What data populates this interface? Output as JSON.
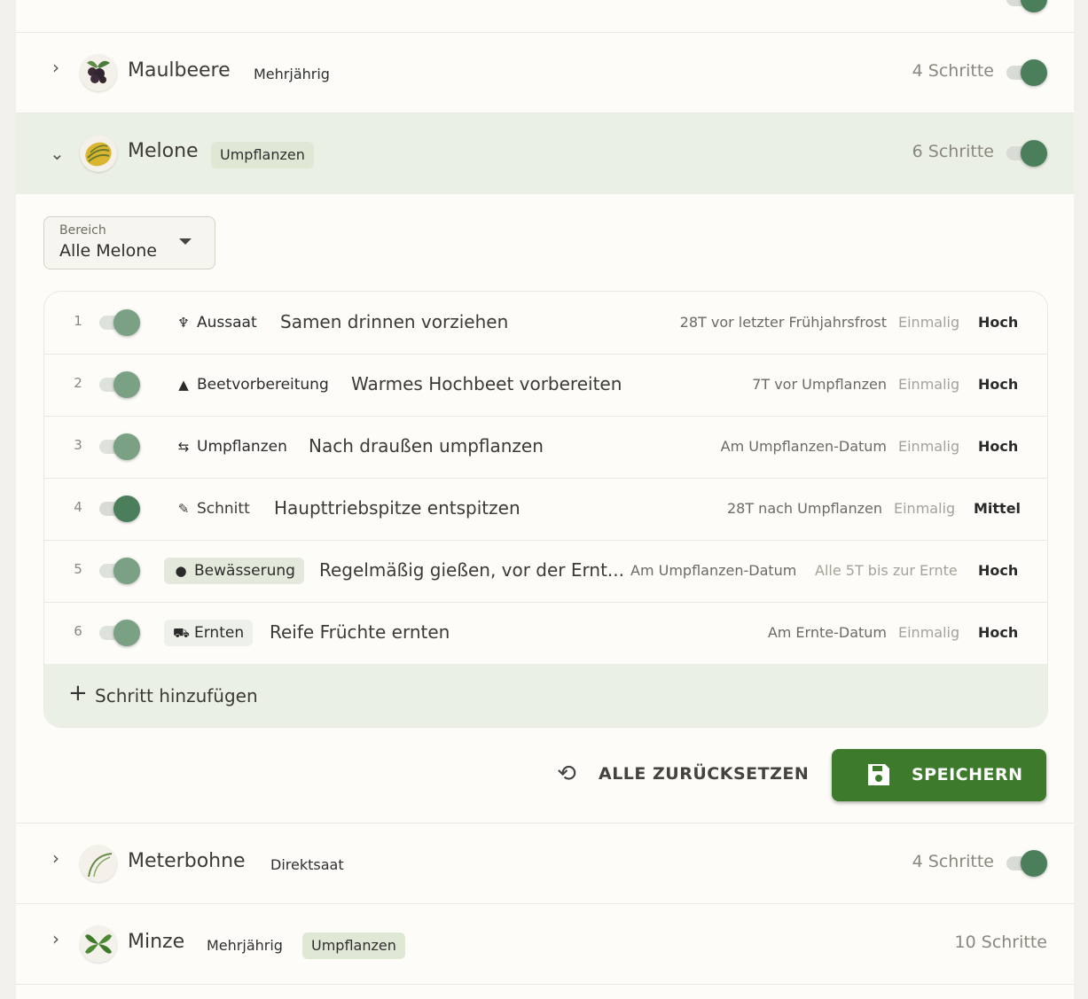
{
  "crops": {
    "maulbeere": {
      "name": "Maulbeere",
      "tags": [
        "Mehrjährig"
      ],
      "steps": "4 Schritte",
      "icon": "mulberry-icon",
      "enabled": true
    },
    "melone": {
      "name": "Melone",
      "tags": [
        "Umpflanzen"
      ],
      "steps": "6 Schritte",
      "icon": "melon-icon",
      "enabled": true
    },
    "meterbohne": {
      "name": "Meterbohne",
      "tags": [
        "Direktsaat"
      ],
      "steps": "4 Schritte",
      "icon": "bean-icon",
      "enabled": true
    },
    "minze": {
      "name": "Minze",
      "tags": [
        "Mehrjährig",
        "Umpflanzen"
      ],
      "steps": "10 Schritte",
      "icon": "mint-icon"
    }
  },
  "filter": {
    "label": "Bereich",
    "value": "Alle Melone"
  },
  "steps": [
    {
      "num": "1",
      "category": "Aussaat",
      "icon": "seedling-icon",
      "title": "Samen drinnen vorziehen",
      "timing": "28T vor letzter Frühjahrsfrost",
      "freq": "Einmalig",
      "prio": "Hoch",
      "enabled": true
    },
    {
      "num": "2",
      "category": "Beetvorbereitung",
      "icon": "mountain-icon",
      "title": "Warmes Hochbeet vorbereiten",
      "timing": "7T vor Umpflanzen",
      "freq": "Einmalig",
      "prio": "Hoch",
      "enabled": true
    },
    {
      "num": "3",
      "category": "Umpflanzen",
      "icon": "transplant-icon",
      "title": "Nach draußen umpflanzen",
      "timing": "Am Umpflanzen-Datum",
      "freq": "Einmalig",
      "prio": "Hoch",
      "enabled": true
    },
    {
      "num": "4",
      "category": "Schnitt",
      "icon": "knife-icon",
      "title": "Haupttriebspitze entspitzen",
      "timing": "28T nach Umpflanzen",
      "freq": "Einmalig",
      "prio": "Mittel",
      "enabled": true
    },
    {
      "num": "5",
      "category": "Bewässerung",
      "icon": "water-drop-icon",
      "title": "Regelmäßig gießen, vor der Ernt...",
      "timing": "Am Umpflanzen-Datum",
      "freq": "Alle 5T bis zur Ernte",
      "prio": "Hoch",
      "enabled": true
    },
    {
      "num": "6",
      "category": "Ernten",
      "icon": "tractor-icon",
      "title": "Reife Früchte ernten",
      "timing": "Am Ernte-Datum",
      "freq": "Einmalig",
      "prio": "Hoch",
      "enabled": true
    }
  ],
  "actions": {
    "add_step": "Schritt hinzufügen",
    "reset": "ALLE ZURÜCKSETZEN",
    "save": "SPEICHERN"
  },
  "colors": {
    "accent_green": "#3e7a2c",
    "toggle_knob": "#4b7f5c",
    "expanded_bg": "#ebf0e6",
    "tag_bg": "#dfe7d5"
  }
}
